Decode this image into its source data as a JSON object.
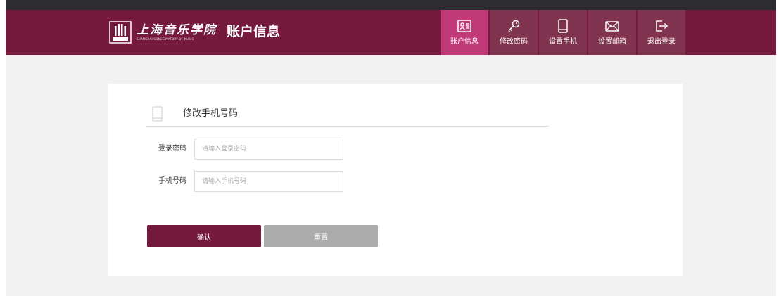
{
  "brand": {
    "school_name_cn": "上海音乐学院",
    "school_name_en": "SHANGHAI CONSERVATORY OF MUSIC"
  },
  "header": {
    "title": "账户信息"
  },
  "nav": {
    "items": [
      {
        "label": "账户信息",
        "icon": "id-card-icon",
        "active": true
      },
      {
        "label": "修改密码",
        "icon": "key-icon",
        "active": false
      },
      {
        "label": "设置手机",
        "icon": "phone-icon",
        "active": false
      },
      {
        "label": "设置邮箱",
        "icon": "mail-icon",
        "active": false
      },
      {
        "label": "退出登录",
        "icon": "logout-icon",
        "active": false
      }
    ]
  },
  "form": {
    "section_title": "修改手机号码",
    "password_label": "登录密码",
    "password_placeholder": "请输入登录密码",
    "phone_label": "手机号码",
    "phone_placeholder": "请输入手机号码",
    "confirm_label": "确认",
    "reset_label": "重置"
  },
  "colors": {
    "header_bg": "#751a3c",
    "nav_active_bg": "#c13b78",
    "confirm_button": "#751a3c",
    "reset_button": "#acacac"
  }
}
